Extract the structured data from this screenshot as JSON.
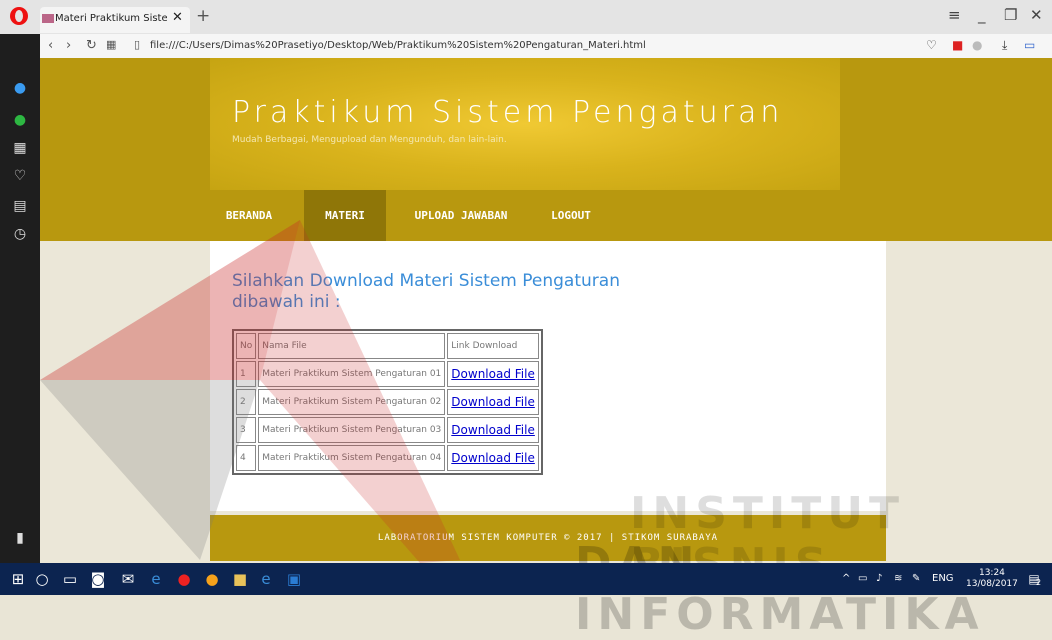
{
  "browser": {
    "tab_title": "Materi Praktikum Sistem P",
    "tab_close": "✕",
    "new_tab": "+",
    "url": "file:///C:/Users/Dimas%20Prasetiyo/Desktop/Web/Praktikum%20Sistem%20Pengaturan_Materi.html"
  },
  "site": {
    "title": "Praktikum Sistem Pengaturan",
    "subtitle": "Mudah Berbagai, Mengupload dan Mengunduh, dan lain-lain.",
    "menu": [
      {
        "label": "BERANDA",
        "active": false
      },
      {
        "label": "MATERI",
        "active": true
      },
      {
        "label": "UPLOAD JAWABAN",
        "active": false
      },
      {
        "label": "LOGOUT",
        "active": false
      }
    ],
    "heading": "Silahkan Download Materi Sistem Pengaturan dibawah ini :",
    "table": {
      "headers": [
        "No",
        "Nama File",
        "Link Download"
      ],
      "rows": [
        {
          "no": "1",
          "name": "Materi Praktikum Sistem Pengaturan 01",
          "link": "Download File"
        },
        {
          "no": "2",
          "name": "Materi Praktikum Sistem Pengaturan 02",
          "link": "Download File"
        },
        {
          "no": "3",
          "name": "Materi Praktikum Sistem Pengaturan 03",
          "link": "Download File"
        },
        {
          "no": "4",
          "name": "Materi Praktikum Sistem Pengaturan 04",
          "link": "Download File"
        }
      ]
    },
    "footer": "LABORATORIUM SISTEM KOMPUTER © 2017 | STIKOM SURABAYA"
  },
  "watermark": {
    "line1": "INSTITUT BISNIS",
    "line2": "DAN INFORMATIKA"
  },
  "taskbar": {
    "lang": "ENG",
    "time": "13:24",
    "date": "13/08/2017",
    "notifications": "2"
  },
  "colors": {
    "header_gold": "#b8980f",
    "menu_active": "#8f7608",
    "heading_blue": "#3a8dd8",
    "link_blue": "#0000cc",
    "taskbar": "#0c2450"
  }
}
